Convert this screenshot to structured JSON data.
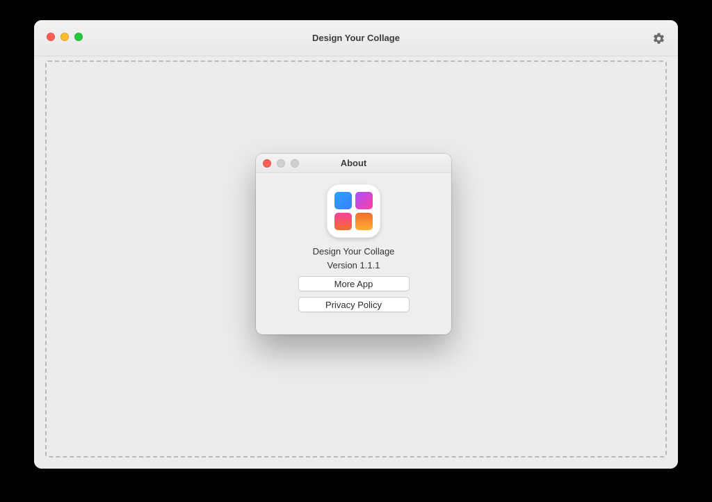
{
  "main_window": {
    "title": "Design Your Collage"
  },
  "about": {
    "title": "About",
    "app_name": "Design Your Collage",
    "version_label": "Version 1.1.1",
    "more_app_label": "More App",
    "privacy_label": "Privacy Policy"
  }
}
